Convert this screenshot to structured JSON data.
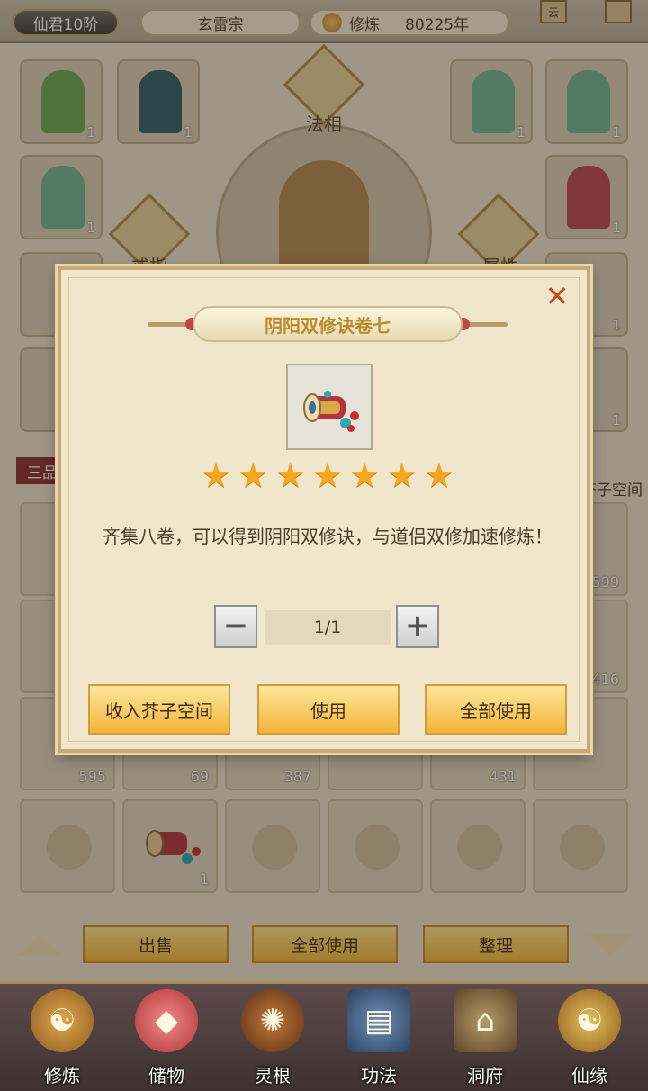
{
  "header": {
    "rank": "仙君10阶",
    "sect": "玄雷宗",
    "cultivation_label": "修炼",
    "cultivation_value": "80225年",
    "cloud_tag": "云"
  },
  "equipment": {
    "center_label": "法相",
    "left_label": "戒指",
    "right_label": "属性",
    "slot_counts": [
      "1",
      "1",
      "1",
      "1",
      "1",
      "1",
      "1",
      "1"
    ],
    "tier_tab": "三品",
    "side_label": "芥子空间"
  },
  "inventory": {
    "counts_row1": [
      "599",
      "2416"
    ],
    "counts_row2": [
      "595",
      "69",
      "387",
      "431"
    ],
    "counts_row3": [
      "1"
    ]
  },
  "bottom_actions": {
    "sell": "出售",
    "use_all": "全部使用",
    "sort": "整理"
  },
  "dialog": {
    "title": "阴阳双修诀卷七",
    "stars": 7,
    "description": "齐集八卷，可以得到阴阳双修诀，与道侣双修加速修炼！",
    "quantity": "1/1",
    "store_label": "收入芥子空间",
    "use_label": "使用",
    "use_all_label": "全部使用"
  },
  "nav": [
    {
      "label": "修炼",
      "icon": "cultivate-icon"
    },
    {
      "label": "储物",
      "icon": "storage-bag-icon"
    },
    {
      "label": "灵根",
      "icon": "spirit-root-icon"
    },
    {
      "label": "功法",
      "icon": "technique-book-icon"
    },
    {
      "label": "洞府",
      "icon": "cave-dwelling-icon"
    },
    {
      "label": "仙缘",
      "icon": "immortal-fate-icon"
    }
  ],
  "colors": {
    "accent_gold": "#f2b43a",
    "close_orange": "#c24d18",
    "star": "#f6a51c",
    "title_text": "#b98a2a"
  }
}
